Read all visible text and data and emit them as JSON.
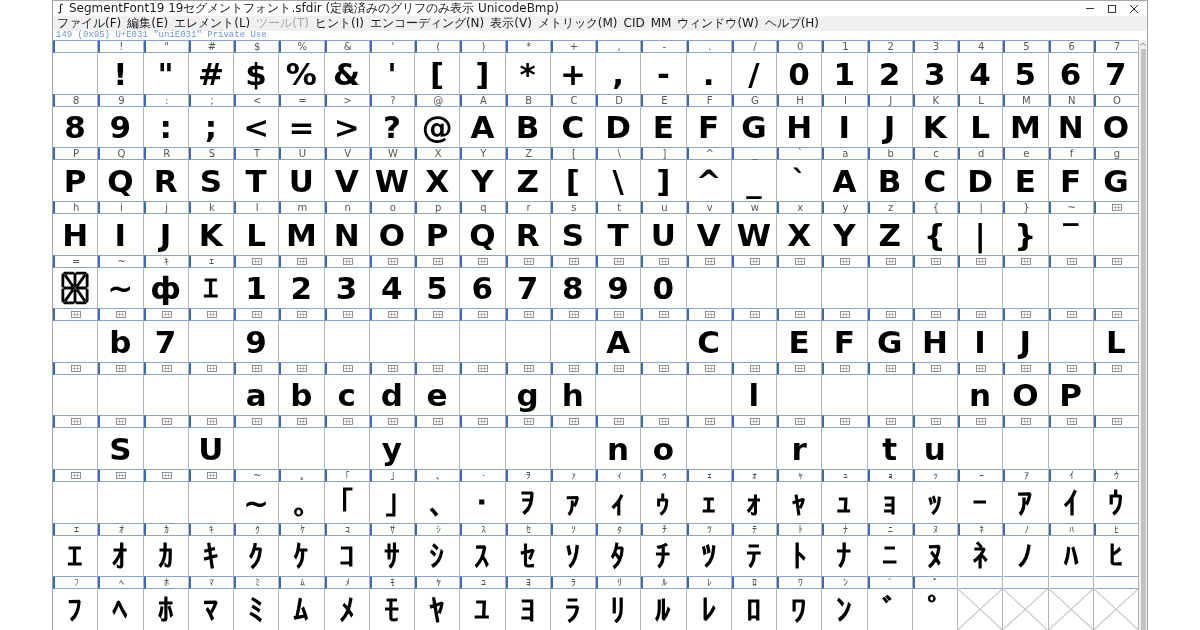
{
  "window": {
    "title": "SegmentFont19  19セグメントフォント.sfdir (定義済みのグリフのみ表示 UnicodeBmp)"
  },
  "menu": [
    {
      "label": "ファイル(F)",
      "disabled": false
    },
    {
      "label": "編集(E)",
      "disabled": false
    },
    {
      "label": "エレメント(L)",
      "disabled": false
    },
    {
      "label": "ツール(T)",
      "disabled": true
    },
    {
      "label": "ヒント(I)",
      "disabled": false
    },
    {
      "label": "エンコーディング(N)",
      "disabled": false
    },
    {
      "label": "表示(V)",
      "disabled": false
    },
    {
      "label": "メトリック(M)",
      "disabled": false
    },
    {
      "label": "CID",
      "disabled": false
    },
    {
      "label": "MM",
      "disabled": false
    },
    {
      "label": "ウィンドウ(W)",
      "disabled": false
    },
    {
      "label": "ヘルプ(H)",
      "disabled": false
    }
  ],
  "status_line": "149 (0x95) U+E031 \"uniE031\" Private Use",
  "grid": {
    "rows": [
      {
        "cells": [
          {
            "kind": "char"
          },
          {
            "kind": "char",
            "label": "!",
            "glyph": "!"
          },
          {
            "kind": "char",
            "label": "\"",
            "glyph": "\""
          },
          {
            "kind": "char",
            "label": "#",
            "glyph": "#"
          },
          {
            "kind": "char",
            "label": "$",
            "glyph": "$"
          },
          {
            "kind": "char",
            "label": "%",
            "glyph": "%"
          },
          {
            "kind": "char",
            "label": "&",
            "glyph": "&"
          },
          {
            "kind": "char",
            "label": "'",
            "glyph": "'"
          },
          {
            "kind": "char",
            "label": "(",
            "glyph": "["
          },
          {
            "kind": "char",
            "label": ")",
            "glyph": "]"
          },
          {
            "kind": "char",
            "label": "*",
            "glyph": "*"
          },
          {
            "kind": "char",
            "label": "+",
            "glyph": "+"
          },
          {
            "kind": "char",
            "label": ",",
            "glyph": ","
          },
          {
            "kind": "char",
            "label": "-",
            "glyph": "-"
          },
          {
            "kind": "char",
            "label": ".",
            "glyph": "."
          },
          {
            "kind": "char",
            "label": "/",
            "glyph": "/"
          },
          {
            "kind": "char",
            "label": "0",
            "glyph": "0"
          },
          {
            "kind": "char",
            "label": "1",
            "glyph": "1"
          },
          {
            "kind": "char",
            "label": "2",
            "glyph": "2"
          },
          {
            "kind": "char",
            "label": "3",
            "glyph": "3"
          },
          {
            "kind": "char",
            "label": "4",
            "glyph": "4"
          },
          {
            "kind": "char",
            "label": "5",
            "glyph": "5"
          },
          {
            "kind": "char",
            "label": "6",
            "glyph": "6"
          },
          {
            "kind": "char",
            "label": "7",
            "glyph": "7"
          }
        ]
      },
      {
        "cells": [
          {
            "kind": "char",
            "label": "8",
            "glyph": "8"
          },
          {
            "kind": "char",
            "label": "9",
            "glyph": "9"
          },
          {
            "kind": "char",
            "label": ":",
            "glyph": ":"
          },
          {
            "kind": "char",
            "label": ";",
            "glyph": ";"
          },
          {
            "kind": "char",
            "label": "<",
            "glyph": "<"
          },
          {
            "kind": "char",
            "label": "=",
            "glyph": "="
          },
          {
            "kind": "char",
            "label": ">",
            "glyph": ">"
          },
          {
            "kind": "char",
            "label": "?",
            "glyph": "?"
          },
          {
            "kind": "char",
            "label": "@",
            "glyph": "@"
          },
          {
            "kind": "char",
            "label": "A",
            "glyph": "A"
          },
          {
            "kind": "char",
            "label": "B",
            "glyph": "B"
          },
          {
            "kind": "char",
            "label": "C",
            "glyph": "C"
          },
          {
            "kind": "char",
            "label": "D",
            "glyph": "D"
          },
          {
            "kind": "char",
            "label": "E",
            "glyph": "E"
          },
          {
            "kind": "char",
            "label": "F",
            "glyph": "F"
          },
          {
            "kind": "char",
            "label": "G",
            "glyph": "G"
          },
          {
            "kind": "char",
            "label": "H",
            "glyph": "H"
          },
          {
            "kind": "char",
            "label": "I",
            "glyph": "I"
          },
          {
            "kind": "char",
            "label": "J",
            "glyph": "J"
          },
          {
            "kind": "char",
            "label": "K",
            "glyph": "K"
          },
          {
            "kind": "char",
            "label": "L",
            "glyph": "L"
          },
          {
            "kind": "char",
            "label": "M",
            "glyph": "M"
          },
          {
            "kind": "char",
            "label": "N",
            "glyph": "N"
          },
          {
            "kind": "char",
            "label": "O",
            "glyph": "O"
          }
        ]
      },
      {
        "cells": [
          {
            "kind": "char",
            "label": "P",
            "glyph": "P"
          },
          {
            "kind": "char",
            "label": "Q",
            "glyph": "Q"
          },
          {
            "kind": "char",
            "label": "R",
            "glyph": "R"
          },
          {
            "kind": "char",
            "label": "S",
            "glyph": "S"
          },
          {
            "kind": "char",
            "label": "T",
            "glyph": "T"
          },
          {
            "kind": "char",
            "label": "U",
            "glyph": "U"
          },
          {
            "kind": "char",
            "label": "V",
            "glyph": "V"
          },
          {
            "kind": "char",
            "label": "W",
            "glyph": "W"
          },
          {
            "kind": "char",
            "label": "X",
            "glyph": "X"
          },
          {
            "kind": "char",
            "label": "Y",
            "glyph": "Y"
          },
          {
            "kind": "char",
            "label": "Z",
            "glyph": "Z"
          },
          {
            "kind": "char",
            "label": "[",
            "glyph": "["
          },
          {
            "kind": "char",
            "label": "\\",
            "glyph": "\\"
          },
          {
            "kind": "char",
            "label": "]",
            "glyph": "]"
          },
          {
            "kind": "char",
            "label": "^",
            "glyph": "^"
          },
          {
            "kind": "char",
            "label": "_",
            "glyph": "_"
          },
          {
            "kind": "char",
            "label": "`",
            "glyph": "`"
          },
          {
            "kind": "char",
            "label": "a",
            "glyph": "A"
          },
          {
            "kind": "char",
            "label": "b",
            "glyph": "B"
          },
          {
            "kind": "char",
            "label": "c",
            "glyph": "C"
          },
          {
            "kind": "char",
            "label": "d",
            "glyph": "D"
          },
          {
            "kind": "char",
            "label": "e",
            "glyph": "E"
          },
          {
            "kind": "char",
            "label": "f",
            "glyph": "F"
          },
          {
            "kind": "char",
            "label": "g",
            "glyph": "G"
          }
        ]
      },
      {
        "cells": [
          {
            "kind": "char",
            "label": "h",
            "glyph": "H"
          },
          {
            "kind": "char",
            "label": "i",
            "glyph": "I"
          },
          {
            "kind": "char",
            "label": "j",
            "glyph": "J"
          },
          {
            "kind": "char",
            "label": "k",
            "glyph": "K"
          },
          {
            "kind": "char",
            "label": "l",
            "glyph": "L"
          },
          {
            "kind": "char",
            "label": "m",
            "glyph": "M"
          },
          {
            "kind": "char",
            "label": "n",
            "glyph": "N"
          },
          {
            "kind": "char",
            "label": "o",
            "glyph": "O"
          },
          {
            "kind": "char",
            "label": "p",
            "glyph": "P"
          },
          {
            "kind": "char",
            "label": "q",
            "glyph": "Q"
          },
          {
            "kind": "char",
            "label": "r",
            "glyph": "R"
          },
          {
            "kind": "char",
            "label": "s",
            "glyph": "S"
          },
          {
            "kind": "char",
            "label": "t",
            "glyph": "T"
          },
          {
            "kind": "char",
            "label": "u",
            "glyph": "U"
          },
          {
            "kind": "char",
            "label": "v",
            "glyph": "V"
          },
          {
            "kind": "char",
            "label": "w",
            "glyph": "W"
          },
          {
            "kind": "char",
            "label": "x",
            "glyph": "X"
          },
          {
            "kind": "char",
            "label": "y",
            "glyph": "Y"
          },
          {
            "kind": "char",
            "label": "z",
            "glyph": "Z"
          },
          {
            "kind": "char",
            "label": "{",
            "glyph": "{"
          },
          {
            "kind": "char",
            "label": "|",
            "glyph": "|"
          },
          {
            "kind": "char",
            "label": "}",
            "glyph": "}"
          },
          {
            "kind": "char",
            "label": "~",
            "glyph": "‾"
          },
          {
            "kind": "code"
          }
        ]
      },
      {
        "cells": [
          {
            "kind": "pattern",
            "label": "="
          },
          {
            "kind": "char",
            "label": "~",
            "glyph": "∼"
          },
          {
            "kind": "char",
            "label": "ｷ",
            "glyph": "ф"
          },
          {
            "kind": "char",
            "label": "ｴ",
            "glyph": "ｴ"
          },
          {
            "kind": "code",
            "glyph": "1"
          },
          {
            "kind": "code",
            "glyph": "2"
          },
          {
            "kind": "code",
            "glyph": "3"
          },
          {
            "kind": "code",
            "glyph": "4"
          },
          {
            "kind": "code",
            "glyph": "5"
          },
          {
            "kind": "code",
            "glyph": "6"
          },
          {
            "kind": "code",
            "glyph": "7"
          },
          {
            "kind": "code",
            "glyph": "8"
          },
          {
            "kind": "code",
            "glyph": "9"
          },
          {
            "kind": "code",
            "glyph": "0"
          },
          {
            "kind": "code"
          },
          {
            "kind": "code"
          },
          {
            "kind": "code"
          },
          {
            "kind": "code"
          },
          {
            "kind": "code"
          },
          {
            "kind": "code"
          },
          {
            "kind": "code"
          },
          {
            "kind": "code"
          },
          {
            "kind": "code"
          },
          {
            "kind": "code"
          }
        ]
      },
      {
        "cells": [
          {
            "kind": "code"
          },
          {
            "kind": "code",
            "glyph": "b"
          },
          {
            "kind": "code",
            "glyph": "7"
          },
          {
            "kind": "code"
          },
          {
            "kind": "code",
            "glyph": "9"
          },
          {
            "kind": "code"
          },
          {
            "kind": "code"
          },
          {
            "kind": "code"
          },
          {
            "kind": "code"
          },
          {
            "kind": "code"
          },
          {
            "kind": "code"
          },
          {
            "kind": "code"
          },
          {
            "kind": "code",
            "glyph": "A"
          },
          {
            "kind": "code"
          },
          {
            "kind": "code",
            "glyph": "C"
          },
          {
            "kind": "code"
          },
          {
            "kind": "code",
            "glyph": "E"
          },
          {
            "kind": "code",
            "glyph": "F"
          },
          {
            "kind": "code",
            "glyph": "G"
          },
          {
            "kind": "code",
            "glyph": "H"
          },
          {
            "kind": "code",
            "glyph": "I"
          },
          {
            "kind": "code",
            "glyph": "J"
          },
          {
            "kind": "code"
          },
          {
            "kind": "code",
            "glyph": "L"
          }
        ]
      },
      {
        "cells": [
          {
            "kind": "code"
          },
          {
            "kind": "code"
          },
          {
            "kind": "code"
          },
          {
            "kind": "code"
          },
          {
            "kind": "code",
            "glyph": "a"
          },
          {
            "kind": "code",
            "glyph": "b"
          },
          {
            "kind": "code",
            "glyph": "c"
          },
          {
            "kind": "code",
            "glyph": "d"
          },
          {
            "kind": "code",
            "glyph": "e"
          },
          {
            "kind": "code"
          },
          {
            "kind": "code",
            "glyph": "g"
          },
          {
            "kind": "code",
            "glyph": "h"
          },
          {
            "kind": "code"
          },
          {
            "kind": "code"
          },
          {
            "kind": "code"
          },
          {
            "kind": "code",
            "glyph": "l"
          },
          {
            "kind": "code"
          },
          {
            "kind": "code"
          },
          {
            "kind": "code"
          },
          {
            "kind": "code"
          },
          {
            "kind": "code",
            "glyph": "n"
          },
          {
            "kind": "code",
            "glyph": "O"
          },
          {
            "kind": "code",
            "glyph": "P"
          },
          {
            "kind": "code"
          }
        ]
      },
      {
        "cells": [
          {
            "kind": "code"
          },
          {
            "kind": "code",
            "glyph": "S"
          },
          {
            "kind": "code"
          },
          {
            "kind": "code",
            "glyph": "U"
          },
          {
            "kind": "code"
          },
          {
            "kind": "code"
          },
          {
            "kind": "code"
          },
          {
            "kind": "code",
            "glyph": "y"
          },
          {
            "kind": "code"
          },
          {
            "kind": "code"
          },
          {
            "kind": "code"
          },
          {
            "kind": "code"
          },
          {
            "kind": "code",
            "glyph": "n"
          },
          {
            "kind": "code",
            "glyph": "o"
          },
          {
            "kind": "code"
          },
          {
            "kind": "code"
          },
          {
            "kind": "code",
            "glyph": "r"
          },
          {
            "kind": "code"
          },
          {
            "kind": "code",
            "glyph": "t"
          },
          {
            "kind": "code",
            "glyph": "u"
          },
          {
            "kind": "code"
          },
          {
            "kind": "code"
          },
          {
            "kind": "code"
          },
          {
            "kind": "code"
          }
        ]
      },
      {
        "cells": [
          {
            "kind": "code"
          },
          {
            "kind": "code"
          },
          {
            "kind": "code"
          },
          {
            "kind": "code"
          },
          {
            "kind": "char",
            "label": "~",
            "glyph": "∼"
          },
          {
            "kind": "char",
            "label": "｡",
            "glyph": "｡"
          },
          {
            "kind": "char",
            "label": "｢",
            "glyph": "｢"
          },
          {
            "kind": "char",
            "label": "｣",
            "glyph": "｣"
          },
          {
            "kind": "char",
            "label": "､",
            "glyph": "､"
          },
          {
            "kind": "char",
            "label": "･",
            "glyph": "･"
          },
          {
            "kind": "char",
            "label": "ｦ",
            "glyph": "ｦ"
          },
          {
            "kind": "char",
            "label": "ｧ",
            "glyph": "ｧ"
          },
          {
            "kind": "char",
            "label": "ｨ",
            "glyph": "ｨ"
          },
          {
            "kind": "char",
            "label": "ｩ",
            "glyph": "ｩ"
          },
          {
            "kind": "char",
            "label": "ｪ",
            "glyph": "ｪ"
          },
          {
            "kind": "char",
            "label": "ｫ",
            "glyph": "ｫ"
          },
          {
            "kind": "char",
            "label": "ｬ",
            "glyph": "ｬ"
          },
          {
            "kind": "char",
            "label": "ｭ",
            "glyph": "ｭ"
          },
          {
            "kind": "char",
            "label": "ｮ",
            "glyph": "ｮ"
          },
          {
            "kind": "char",
            "label": "ｯ",
            "glyph": "ｯ"
          },
          {
            "kind": "char",
            "label": "ｰ",
            "glyph": "ｰ"
          },
          {
            "kind": "char",
            "label": "ｱ",
            "glyph": "ｱ"
          },
          {
            "kind": "char",
            "label": "ｲ",
            "glyph": "ｲ"
          },
          {
            "kind": "char",
            "label": "ｳ",
            "glyph": "ｳ"
          }
        ]
      },
      {
        "cells": [
          {
            "kind": "char",
            "label": "ｴ",
            "glyph": "ｴ"
          },
          {
            "kind": "char",
            "label": "ｵ",
            "glyph": "ｵ"
          },
          {
            "kind": "char",
            "label": "ｶ",
            "glyph": "ｶ"
          },
          {
            "kind": "char",
            "label": "ｷ",
            "glyph": "ｷ"
          },
          {
            "kind": "char",
            "label": "ｸ",
            "glyph": "ｸ"
          },
          {
            "kind": "char",
            "label": "ｹ",
            "glyph": "ｹ"
          },
          {
            "kind": "char",
            "label": "ｺ",
            "glyph": "ｺ"
          },
          {
            "kind": "char",
            "label": "ｻ",
            "glyph": "ｻ"
          },
          {
            "kind": "char",
            "label": "ｼ",
            "glyph": "ｼ"
          },
          {
            "kind": "char",
            "label": "ｽ",
            "glyph": "ｽ"
          },
          {
            "kind": "char",
            "label": "ｾ",
            "glyph": "ｾ"
          },
          {
            "kind": "char",
            "label": "ｿ",
            "glyph": "ｿ"
          },
          {
            "kind": "char",
            "label": "ﾀ",
            "glyph": "ﾀ"
          },
          {
            "kind": "char",
            "label": "ﾁ",
            "glyph": "ﾁ"
          },
          {
            "kind": "char",
            "label": "ﾂ",
            "glyph": "ﾂ"
          },
          {
            "kind": "char",
            "label": "ﾃ",
            "glyph": "ﾃ"
          },
          {
            "kind": "char",
            "label": "ﾄ",
            "glyph": "ﾄ"
          },
          {
            "kind": "char",
            "label": "ﾅ",
            "glyph": "ﾅ"
          },
          {
            "kind": "char",
            "label": "ﾆ",
            "glyph": "ﾆ"
          },
          {
            "kind": "char",
            "label": "ﾇ",
            "glyph": "ﾇ"
          },
          {
            "kind": "char",
            "label": "ﾈ",
            "glyph": "ﾈ"
          },
          {
            "kind": "char",
            "label": "ﾉ",
            "glyph": "ﾉ"
          },
          {
            "kind": "char",
            "label": "ﾊ",
            "glyph": "ﾊ"
          },
          {
            "kind": "char",
            "label": "ﾋ",
            "glyph": "ﾋ"
          }
        ]
      },
      {
        "cells": [
          {
            "kind": "char",
            "label": "ﾌ",
            "glyph": "ﾌ"
          },
          {
            "kind": "char",
            "label": "ﾍ",
            "glyph": "ﾍ"
          },
          {
            "kind": "char",
            "label": "ﾎ",
            "glyph": "ﾎ"
          },
          {
            "kind": "char",
            "label": "ﾏ",
            "glyph": "ﾏ"
          },
          {
            "kind": "char",
            "label": "ﾐ",
            "glyph": "ﾐ"
          },
          {
            "kind": "char",
            "label": "ﾑ",
            "glyph": "ﾑ"
          },
          {
            "kind": "char",
            "label": "ﾒ",
            "glyph": "ﾒ"
          },
          {
            "kind": "char",
            "label": "ﾓ",
            "glyph": "ﾓ"
          },
          {
            "kind": "char",
            "label": "ﾔ",
            "glyph": "ﾔ"
          },
          {
            "kind": "char",
            "label": "ﾕ",
            "glyph": "ﾕ"
          },
          {
            "kind": "char",
            "label": "ﾖ",
            "glyph": "ﾖ"
          },
          {
            "kind": "char",
            "label": "ﾗ",
            "glyph": "ﾗ"
          },
          {
            "kind": "char",
            "label": "ﾘ",
            "glyph": "ﾘ"
          },
          {
            "kind": "char",
            "label": "ﾙ",
            "glyph": "ﾙ"
          },
          {
            "kind": "char",
            "label": "ﾚ",
            "glyph": "ﾚ"
          },
          {
            "kind": "char",
            "label": "ﾛ",
            "glyph": "ﾛ"
          },
          {
            "kind": "char",
            "label": "ﾜ",
            "glyph": "ﾜ"
          },
          {
            "kind": "char",
            "label": "ﾝ",
            "glyph": "ﾝ"
          },
          {
            "kind": "char",
            "label": "ﾞ",
            "glyph": "ﾞ"
          },
          {
            "kind": "char",
            "label": "ﾟ",
            "glyph": "ﾟ"
          },
          {
            "kind": "blank"
          },
          {
            "kind": "blank"
          },
          {
            "kind": "blank"
          },
          {
            "kind": "blank"
          }
        ]
      }
    ]
  }
}
